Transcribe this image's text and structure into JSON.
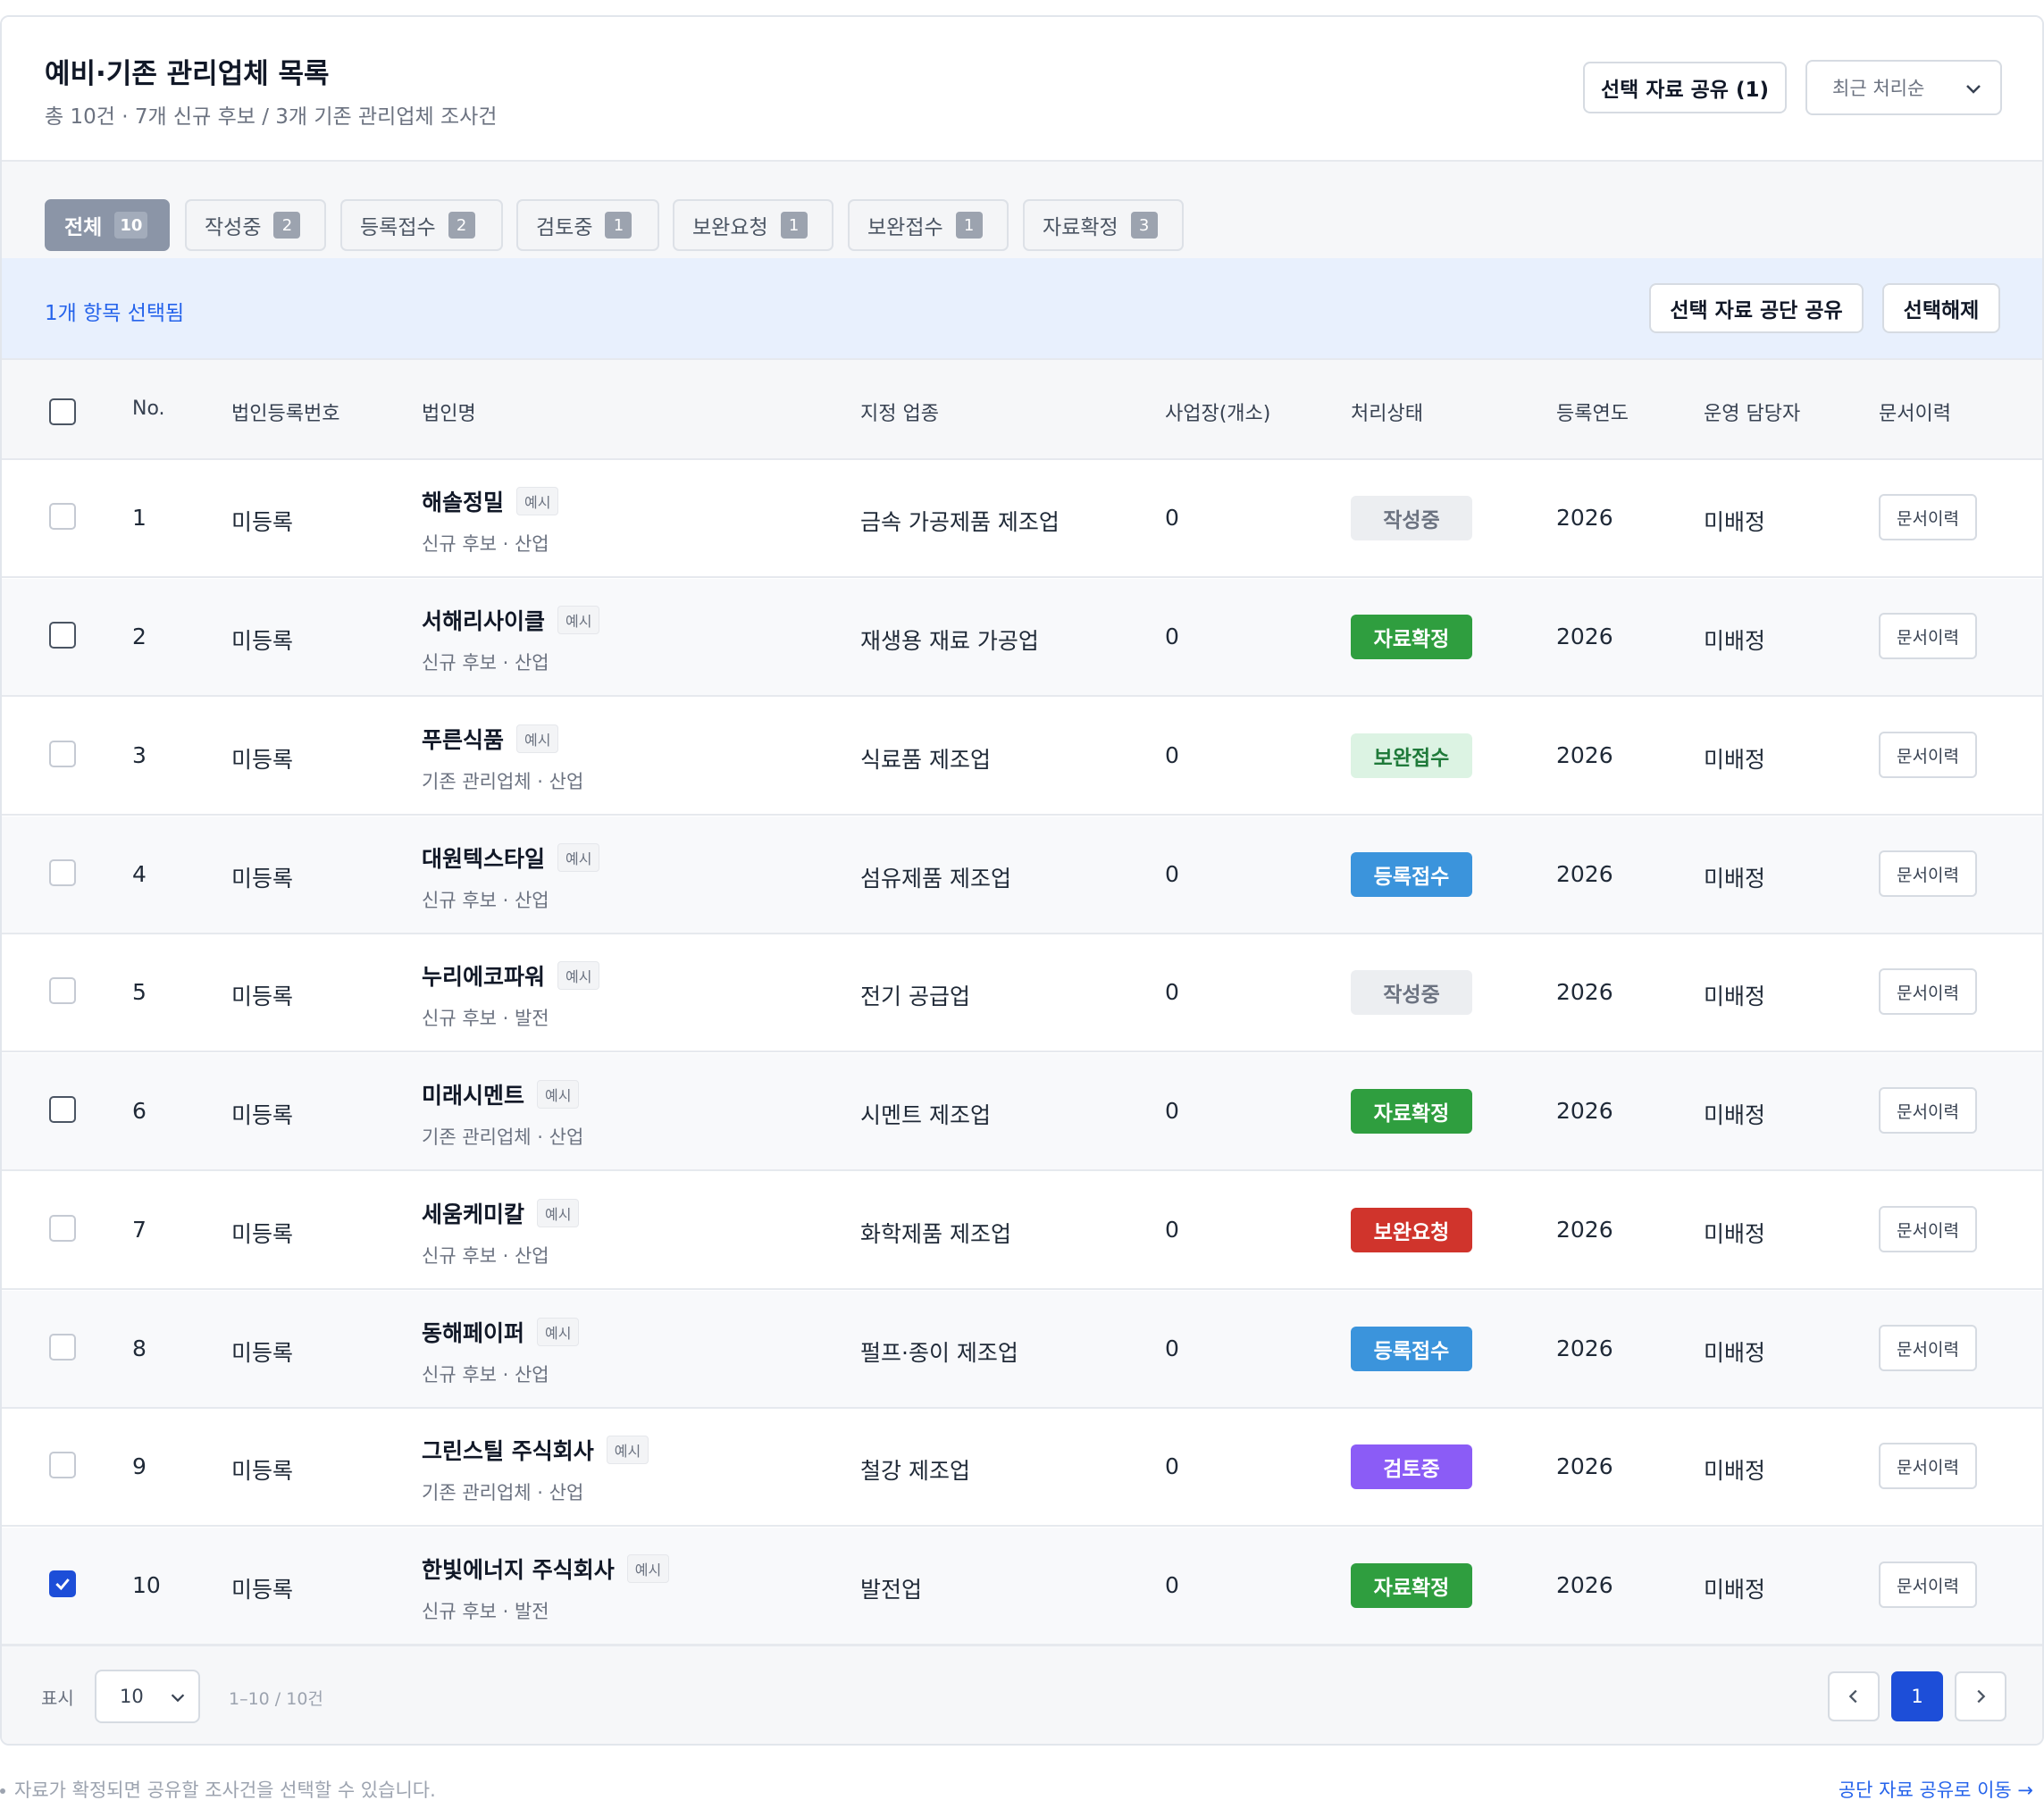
{
  "header": {
    "title": "예비·기존 관리업체 목록",
    "subtitle": "총 10건 · 7개 신규 후보 / 3개 기존 관리업체 조사건",
    "share_button": "선택 자료 공유 (1)",
    "sort": "최근 처리순"
  },
  "tabs": [
    {
      "label": "전체",
      "count": "10"
    },
    {
      "label": "작성중",
      "count": "2"
    },
    {
      "label": "등록접수",
      "count": "2"
    },
    {
      "label": "검토중",
      "count": "1"
    },
    {
      "label": "보완요청",
      "count": "1"
    },
    {
      "label": "보완접수",
      "count": "1"
    },
    {
      "label": "자료확정",
      "count": "3"
    }
  ],
  "selection": {
    "text": "1개 항목 선택됨",
    "share_button": "선택 자료 공단 공유",
    "clear_button": "선택해제"
  },
  "columns": [
    "No.",
    "법인등록번호",
    "법인명",
    "지정 업종",
    "사업장(개소)",
    "처리상태",
    "등록연도",
    "운영 담당자",
    "문서이력"
  ],
  "rows": [
    {
      "no": "1",
      "reg": "미등록",
      "name": "해솔정밀",
      "tag": "예시",
      "sub": "신규 후보 · 산업",
      "industry": "금속 가공제품 제조업",
      "sites": "0",
      "status": "작성중",
      "year": "2026",
      "manager": "미배정",
      "doc": "문서이력"
    },
    {
      "no": "2",
      "reg": "미등록",
      "name": "서해리사이클",
      "tag": "예시",
      "sub": "신규 후보 · 산업",
      "industry": "재생용 재료 가공업",
      "sites": "0",
      "status": "자료확정",
      "year": "2026",
      "manager": "미배정",
      "doc": "문서이력"
    },
    {
      "no": "3",
      "reg": "미등록",
      "name": "푸른식품",
      "tag": "예시",
      "sub": "기존 관리업체 · 산업",
      "industry": "식료품 제조업",
      "sites": "0",
      "status": "보완접수",
      "year": "2026",
      "manager": "미배정",
      "doc": "문서이력"
    },
    {
      "no": "4",
      "reg": "미등록",
      "name": "대원텍스타일",
      "tag": "예시",
      "sub": "신규 후보 · 산업",
      "industry": "섬유제품 제조업",
      "sites": "0",
      "status": "등록접수",
      "year": "2026",
      "manager": "미배정",
      "doc": "문서이력"
    },
    {
      "no": "5",
      "reg": "미등록",
      "name": "누리에코파워",
      "tag": "예시",
      "sub": "신규 후보 · 발전",
      "industry": "전기 공급업",
      "sites": "0",
      "status": "작성중",
      "year": "2026",
      "manager": "미배정",
      "doc": "문서이력"
    },
    {
      "no": "6",
      "reg": "미등록",
      "name": "미래시멘트",
      "tag": "예시",
      "sub": "기존 관리업체 · 산업",
      "industry": "시멘트 제조업",
      "sites": "0",
      "status": "자료확정",
      "year": "2026",
      "manager": "미배정",
      "doc": "문서이력"
    },
    {
      "no": "7",
      "reg": "미등록",
      "name": "세움케미칼",
      "tag": "예시",
      "sub": "신규 후보 · 산업",
      "industry": "화학제품 제조업",
      "sites": "0",
      "status": "보완요청",
      "year": "2026",
      "manager": "미배정",
      "doc": "문서이력"
    },
    {
      "no": "8",
      "reg": "미등록",
      "name": "동해페이퍼",
      "tag": "예시",
      "sub": "신규 후보 · 산업",
      "industry": "펄프·종이 제조업",
      "sites": "0",
      "status": "등록접수",
      "year": "2026",
      "manager": "미배정",
      "doc": "문서이력"
    },
    {
      "no": "9",
      "reg": "미등록",
      "name": "그린스틸 주식회사",
      "tag": "예시",
      "sub": "기존 관리업체 · 산업",
      "industry": "철강 제조업",
      "sites": "0",
      "status": "검토중",
      "year": "2026",
      "manager": "미배정",
      "doc": "문서이력"
    },
    {
      "no": "10",
      "reg": "미등록",
      "name": "한빛에너지 주식회사",
      "tag": "예시",
      "sub": "신규 후보 · 발전",
      "industry": "발전업",
      "sites": "0",
      "status": "자료확정",
      "year": "2026",
      "manager": "미배정",
      "doc": "문서이력"
    }
  ],
  "status_colors": {
    "작성중": {
      "bg": "#eceef1",
      "fg": "#6b7280"
    },
    "자료확정": {
      "bg": "#2f9e3f",
      "fg": "#ffffff"
    },
    "보완접수": {
      "bg": "#dcf3e3",
      "fg": "#1f7a3a"
    },
    "등록접수": {
      "bg": "#3b94dc",
      "fg": "#ffffff"
    },
    "보완요청": {
      "bg": "#d0342c",
      "fg": "#ffffff"
    },
    "검토중": {
      "bg": "#8b5cf6",
      "fg": "#ffffff"
    }
  },
  "pagination": {
    "label": "표시",
    "page_size": "10",
    "range": "1–10 / 10건",
    "current_page": "1"
  },
  "footer": {
    "note": "자료가 확정되면 공유할 조사건을 선택할 수 있습니다.",
    "link": "공단 자료 공유로 이동 →"
  }
}
